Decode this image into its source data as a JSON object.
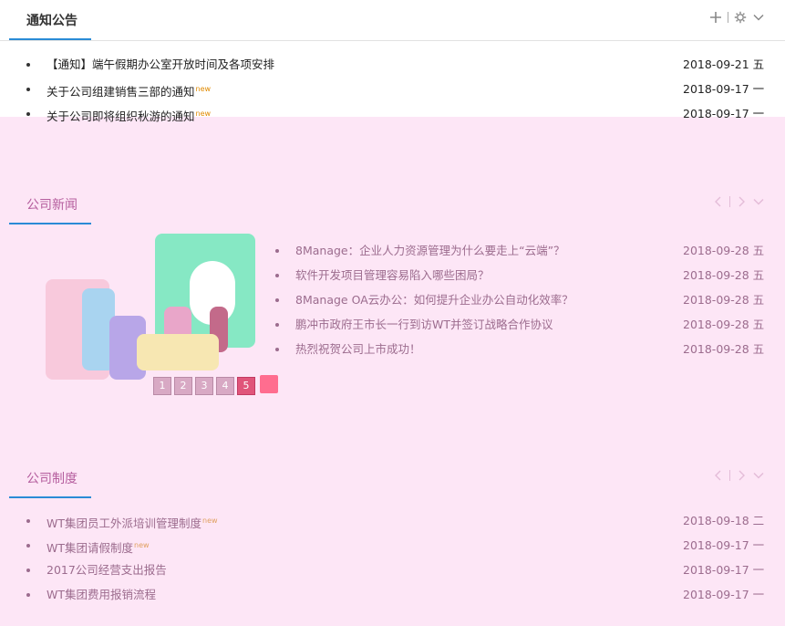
{
  "notices": {
    "title": "通知公告",
    "items": [
      {
        "text": "【通知】端午假期办公室开放时间及各项安排",
        "date": "2018-09-21 五",
        "new": false
      },
      {
        "text": "关于公司组建销售三部的通知",
        "date": "2018-09-17 一",
        "new": true
      },
      {
        "text": "关于公司即将组织秋游的通知",
        "date": "2018-09-17 一",
        "new": true
      }
    ]
  },
  "news": {
    "title": "公司新闻",
    "items": [
      {
        "text": "8Manage：企业人力资源管理为什么要走上“云端”？",
        "date": "2018-09-28 五"
      },
      {
        "text": "软件开发项目管理容易陷入哪些困局？",
        "date": "2018-09-28 五"
      },
      {
        "text": "8Manage OA云办公：如何提升企业办公自动化效率？",
        "date": "2018-09-28 五"
      },
      {
        "text": "鹏冲市政府王市长一行到访WT并签订战略合作协议",
        "date": "2018-09-28 五"
      },
      {
        "text": "热烈祝贺公司上市成功！",
        "date": "2018-09-28 五"
      }
    ],
    "pages": [
      "1",
      "2",
      "3",
      "4",
      "5"
    ]
  },
  "rules": {
    "title": "公司制度",
    "items": [
      {
        "text": "WT集团员工外派培训管理制度",
        "date": "2018-09-18 二",
        "new": true
      },
      {
        "text": "WT集团请假制度",
        "date": "2018-09-17 一",
        "new": true
      },
      {
        "text": "2017公司经营支出报告",
        "date": "2018-09-17 一",
        "new": false
      },
      {
        "text": "WT集团费用报销流程",
        "date": "2018-09-17 一",
        "new": false
      }
    ]
  },
  "new_label": "new",
  "icons": {
    "add": "plus-icon",
    "settings": "gear-icon",
    "collapse": "chevron-down-icon",
    "prev": "chevron-left-icon",
    "next": "chevron-right-icon"
  },
  "colors": {
    "accent": "#2a8bd6",
    "new_badge": "#e08a00",
    "overlay": "#fde6f6"
  }
}
